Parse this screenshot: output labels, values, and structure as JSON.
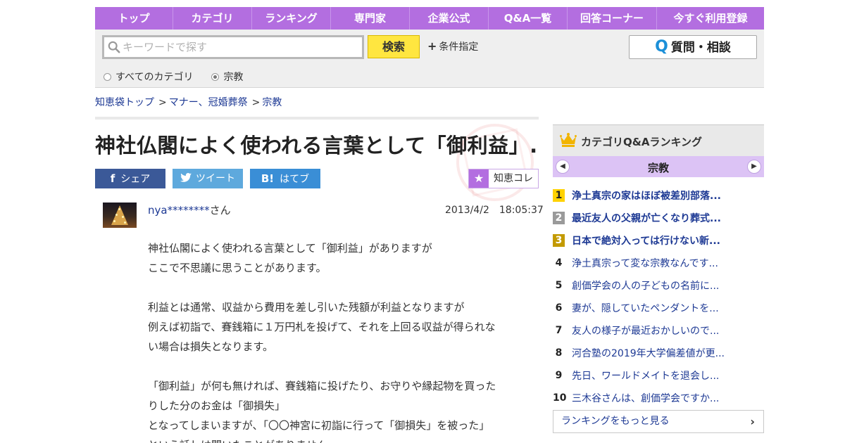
{
  "nav": {
    "items": [
      "トップ",
      "カテゴリ",
      "ランキング",
      "専門家",
      "企業公式",
      "Q&A一覧",
      "回答コーナー",
      "今すぐ利用登録"
    ]
  },
  "search": {
    "placeholder": "キーワードで探す",
    "button": "検索",
    "conditions": "条件指定",
    "ask_button": "質問・相談",
    "ask_q": "Q",
    "scope_all": "すべてのカテゴリ",
    "scope_current": "宗教"
  },
  "breadcrumb": {
    "items": [
      "知恵袋トップ",
      "マナー、冠婚葬祭",
      "宗教"
    ],
    "sep": ">"
  },
  "question": {
    "title": "神社仏閣によく使われる言葉として「御利益」...",
    "share_facebook": "シェア",
    "share_twitter": "ツイート",
    "share_hatena": "はてブ",
    "chiekore": "知恵コレ",
    "user": "nya********",
    "user_suffix": "さん",
    "date": "2013/4/2　18:05:37",
    "body": [
      "神社仏閣によく使われる言葉として「御利益」がありますが",
      "ここで不思議に思うことがあります。",
      "",
      "利益とは通常、収益から費用を差し引いた残額が利益となりますが",
      "例えば初詣で、賽銭箱に１万円札を投げて、それを上回る収益が得られな",
      "い場合は損失となります。",
      "",
      "「御利益」が何も無ければ、賽銭箱に投げたり、お守りや縁起物を買った",
      "りした分のお金は「御損失」",
      "となってしまいますが、「〇〇神宮に初詣に行って「御損失」を被った」",
      "という話しは聞いたことがありません"
    ]
  },
  "sidebar": {
    "heading": "カテゴリQ&Aランキング",
    "category": "宗教",
    "ranking": [
      {
        "rank": "1",
        "text": "浄土真宗の家はほぼ被差別部落..."
      },
      {
        "rank": "2",
        "text": "最近友人の父親が亡くなり葬式..."
      },
      {
        "rank": "3",
        "text": "日本で絶対入っては行けない新..."
      },
      {
        "rank": "4",
        "text": "浄土真宗って変な宗教なんです..."
      },
      {
        "rank": "5",
        "text": "創価学会の人の子どもの名前に..."
      },
      {
        "rank": "6",
        "text": "妻が、隠していたペンダントを..."
      },
      {
        "rank": "7",
        "text": "友人の様子が最近おかしいので..."
      },
      {
        "rank": "8",
        "text": "河合塾の2019年大学偏差値が更..."
      },
      {
        "rank": "9",
        "text": "先日、ワールドメイトを退会し..."
      },
      {
        "rank": "10",
        "text": "三木谷さんは、創価学会ですか..."
      }
    ],
    "more": "ランキングをもっと見る"
  },
  "colors": {
    "nav_bg": "#b36ee0",
    "link": "#1d3994",
    "search_btn": "#ffe640",
    "facebook": "#3b5998",
    "twitter": "#5ea9dd",
    "hatena": "#3a8ed6"
  },
  "icons": {
    "search": "search-icon",
    "plus": "plus-icon",
    "facebook": "facebook-icon",
    "twitter": "twitter-icon",
    "hatena": "hatena-icon",
    "star": "star-icon",
    "crown": "crown-icon",
    "prev": "chevron-left-icon",
    "next": "chevron-right-icon",
    "more": "chevron-right-icon"
  }
}
